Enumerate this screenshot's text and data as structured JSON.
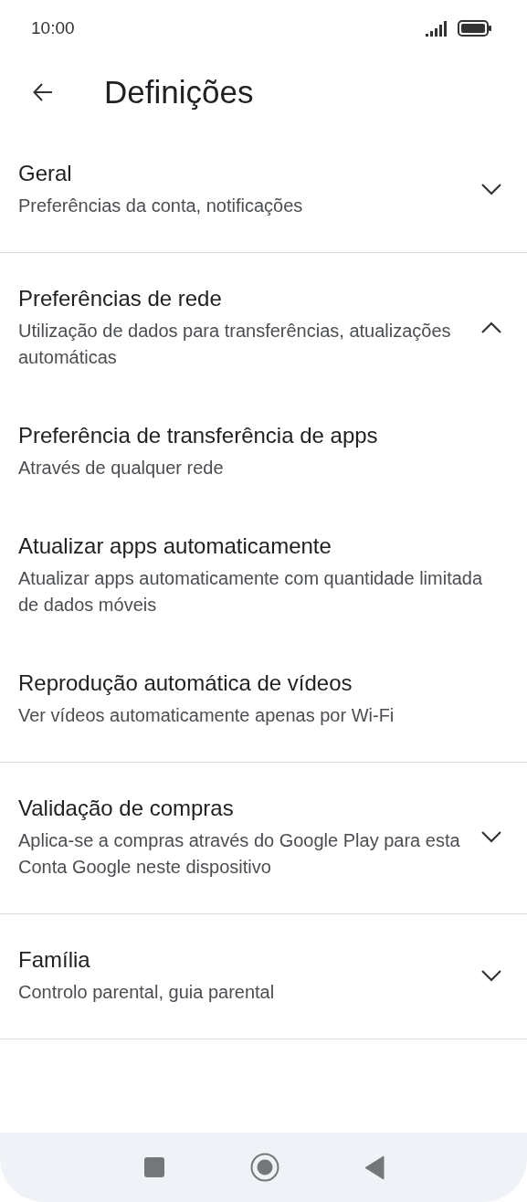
{
  "status_bar": {
    "time": "10:00"
  },
  "header": {
    "title": "Definições"
  },
  "sections": [
    {
      "title": "Geral",
      "subtitle": "Preferências da conta, notificações",
      "expanded": false
    },
    {
      "title": "Preferências de rede",
      "subtitle": "Utilização de dados para transferências, atualizações automáticas",
      "expanded": true,
      "children": [
        {
          "title": "Preferência de transferência de apps",
          "subtitle": "Através de qualquer rede"
        },
        {
          "title": "Atualizar apps automaticamente",
          "subtitle": "Atualizar apps automaticamente com quantidade limitada de dados móveis"
        },
        {
          "title": "Reprodução automática de vídeos",
          "subtitle": "Ver vídeos automaticamente apenas por Wi-Fi"
        }
      ]
    },
    {
      "title": "Validação de compras",
      "subtitle": "Aplica-se a compras através do Google Play para esta Conta Google neste dispositivo",
      "expanded": false
    },
    {
      "title": "Família",
      "subtitle": "Controlo parental, guia parental",
      "expanded": false
    }
  ]
}
